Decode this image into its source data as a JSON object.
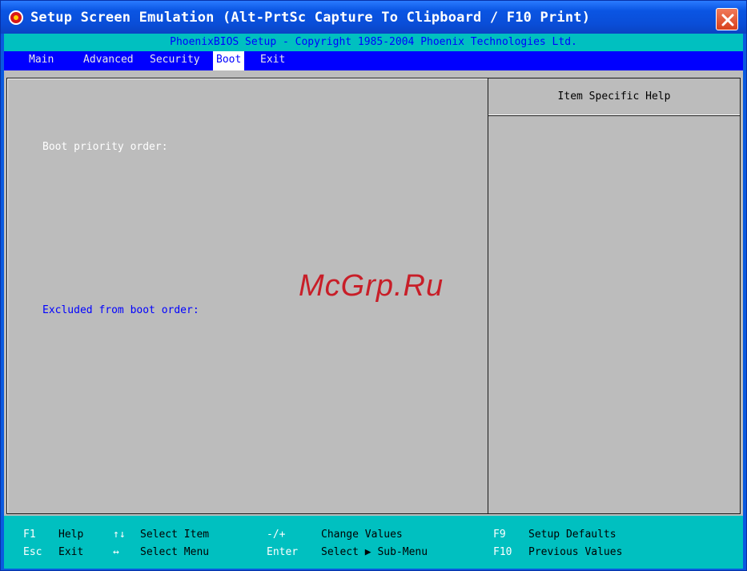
{
  "window": {
    "title": "Setup Screen Emulation (Alt-PrtSc Capture To Clipboard / F10 Print)",
    "close_symbol": "✕"
  },
  "bios": {
    "copyright": "PhoenixBIOS Setup - Copyright 1985-2004 Phoenix Technologies Ltd.",
    "menu": [
      {
        "label": "Main",
        "active": false
      },
      {
        "label": "Advanced",
        "active": false
      },
      {
        "label": "Security",
        "active": false
      },
      {
        "label": "Boot",
        "active": true
      },
      {
        "label": "Exit",
        "active": false
      }
    ],
    "main": {
      "boot_priority_label": "Boot priority order:",
      "excluded_label": "Excluded from boot order:"
    },
    "help": {
      "header": "Item Specific Help"
    },
    "footer": {
      "row1": [
        {
          "key": "F1",
          "desc": "Help"
        },
        {
          "key": "↑↓",
          "desc": "Select Item"
        },
        {
          "key": "-/+",
          "desc": "Change Values"
        },
        {
          "key": "F9",
          "desc": "Setup Defaults"
        }
      ],
      "row2": [
        {
          "key": "Esc",
          "desc": "Exit"
        },
        {
          "key": "↔",
          "desc": "Select Menu"
        },
        {
          "key": "Enter",
          "desc": "Select ▶ Sub-Menu"
        },
        {
          "key": "F10",
          "desc": "Previous Values"
        }
      ]
    }
  },
  "watermark": "McGrp.Ru",
  "colors": {
    "title_bar": "#0a55e3",
    "bios_background": "#bcbcbc",
    "copyright_bar": "#00c0c0",
    "menu_bar": "#0000ff",
    "active_tab_bg": "#ffffff",
    "footer_bar": "#00c0c0",
    "watermark": "#c81e28"
  },
  "icons": {
    "app": "phoenix-bios-app-icon",
    "close": "close-icon",
    "up_down": "up-down-arrows-icon",
    "left_right": "left-right-arrows-icon",
    "submenu": "right-triangle-icon"
  }
}
